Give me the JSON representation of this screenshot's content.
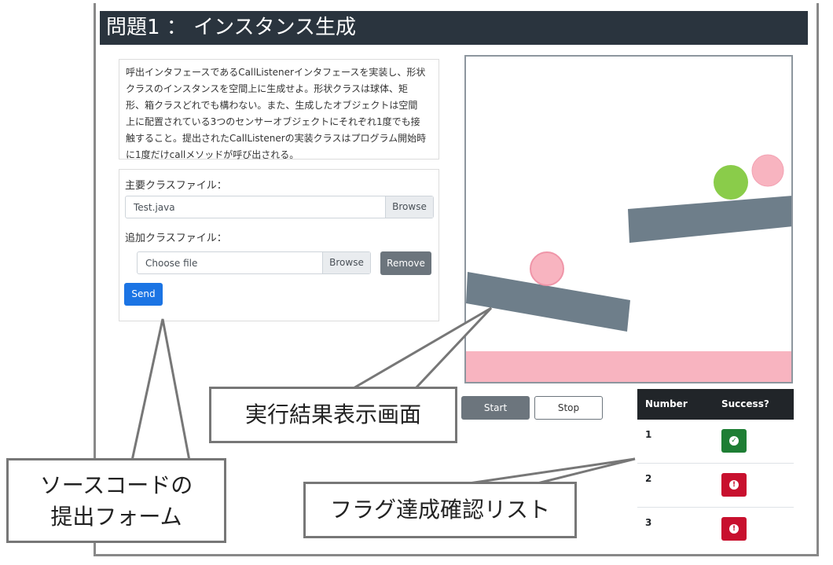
{
  "header": {
    "title": "問題1 ： インスタンス生成"
  },
  "description": {
    "lines": [
      "呼出インタフェースであるCallListenerインタフェースを実装し、形状",
      "クラスのインスタンスを空間上に生成せよ。形状クラスは球体、矩",
      "形、箱クラスどれでも構わない。また、生成したオブジェクトは空間",
      "上に配置されている3つのセンサーオブジェクトにそれぞれ1度でも接",
      "触すること。提出されたCallListenerの実装クラスはプログラム開始時",
      "に1度だけcallメソッドが呼び出される。"
    ]
  },
  "form": {
    "main_label": "主要クラスファイル：",
    "main_file_value": "Test.java",
    "browse_label": "Browse",
    "extra_label": "追加クラスファイル：",
    "extra_placeholder": "Choose file",
    "remove_label": "Remove",
    "send_label": "Send"
  },
  "controls": {
    "start_label": "Start",
    "stop_label": "Stop"
  },
  "results_table": {
    "headers": [
      "Number",
      "Success?"
    ],
    "rows": [
      {
        "number": "1",
        "status": "success",
        "icon": "check-circle-icon"
      },
      {
        "number": "2",
        "status": "fail",
        "icon": "exclamation-circle-icon"
      },
      {
        "number": "3",
        "status": "fail",
        "icon": "exclamation-circle-icon"
      }
    ]
  },
  "annotations": {
    "sim_screen": "実行結果表示画面",
    "submit_form_line1": "ソースコードの",
    "submit_form_line2": "提出フォーム",
    "flag_list": "フラグ達成確認リスト"
  },
  "colors": {
    "header_bg": "#2a343e",
    "primary": "#1b74e4",
    "secondary": "#6c757d",
    "success": "#1e7e34",
    "danger": "#c8102e",
    "sensor_pink": "#f8b4c0",
    "ball_green": "#8acc4a",
    "platform": "#6e7e8a"
  }
}
